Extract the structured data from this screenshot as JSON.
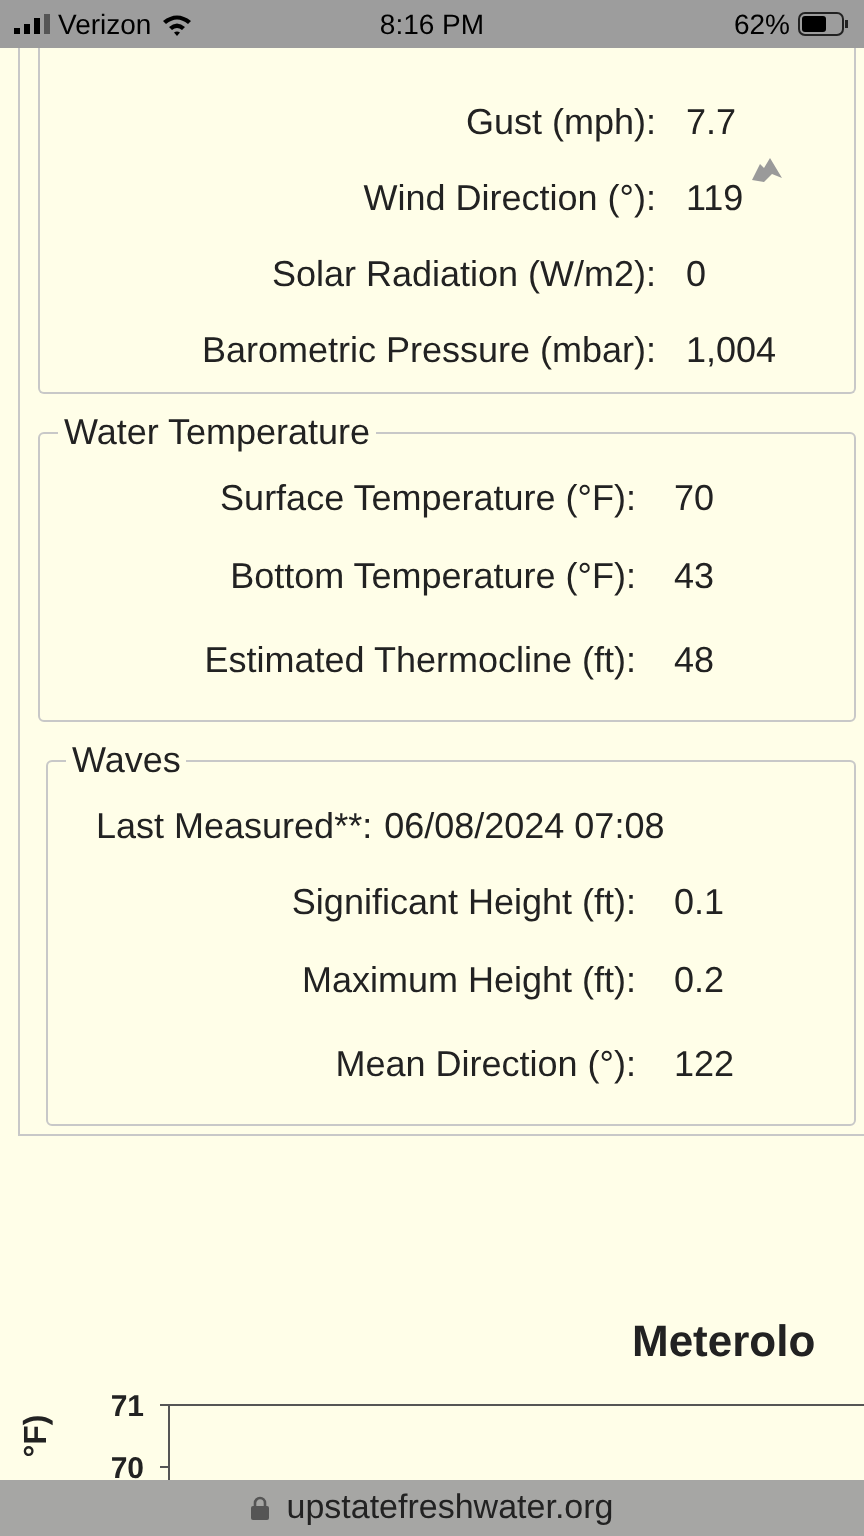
{
  "status_bar": {
    "carrier": "Verizon",
    "time": "8:16 PM",
    "battery": "62%"
  },
  "meteorology": {
    "rows": [
      {
        "label": "Gust (mph):",
        "value": "7.7"
      },
      {
        "label": "Wind Direction (°):",
        "value": "119",
        "direction_arrow": true
      },
      {
        "label": "Solar Radiation (W/m2):",
        "value": "0"
      },
      {
        "label": "Barometric Pressure (mbar):",
        "value": "1,004"
      }
    ]
  },
  "sections": [
    {
      "title": "Water Temperature",
      "rows": [
        {
          "kind": "pair",
          "label": "Surface Temperature (°F):",
          "value": "70"
        },
        {
          "kind": "pair",
          "label": "Bottom Temperature (°F):",
          "value": "43"
        },
        {
          "kind": "pair",
          "label": "Estimated Thermocline (ft):",
          "value": "48"
        }
      ]
    },
    {
      "title": "Waves",
      "rows": [
        {
          "kind": "wide",
          "label": "Last Measured**:",
          "value": "06/08/2024 07:08"
        },
        {
          "kind": "pair",
          "label": "Significant Height (ft):",
          "value": "0.1"
        },
        {
          "kind": "pair",
          "label": "Maximum Height (ft):",
          "value": "0.2"
        },
        {
          "kind": "pair",
          "label": "Mean Direction (°):",
          "value": "122"
        }
      ]
    }
  ],
  "chart": {
    "title": "Meterolo",
    "ylabel": "°F)",
    "yticks": [
      "71",
      "70"
    ]
  },
  "address_bar": {
    "url": "upstatefreshwater.org"
  }
}
